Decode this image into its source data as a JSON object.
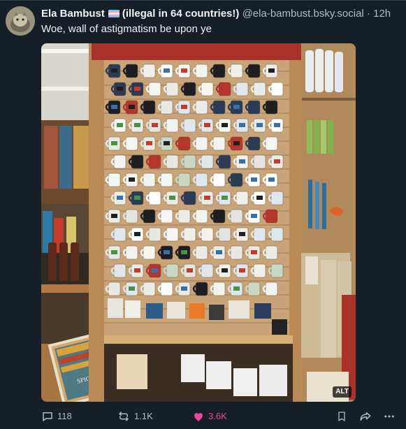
{
  "post": {
    "author": {
      "display_name": "Ela Bambust",
      "name_suffix": "(illegal in 64 countries!)",
      "handle": "@ela-bambust.bsky.social"
    },
    "separator": "·",
    "timestamp": "12h",
    "text": "Woe, wall of astigmatism be upon ye",
    "media": {
      "alt_badge": "ALT",
      "box_label": "SPICE"
    }
  },
  "actions": {
    "reply_count": "118",
    "repost_count": "1.1K",
    "like_count": "3.6K"
  },
  "colors": {
    "background": "#161e27",
    "text_primary": "#f1f3f5",
    "text_secondary": "#aebbc9",
    "like_pink": "#ec4899"
  },
  "icons": [
    "avatar-image",
    "trans-flag-icon",
    "reply-icon",
    "repost-icon",
    "heart-icon",
    "bookmark-icon",
    "share-icon",
    "more-icon"
  ]
}
